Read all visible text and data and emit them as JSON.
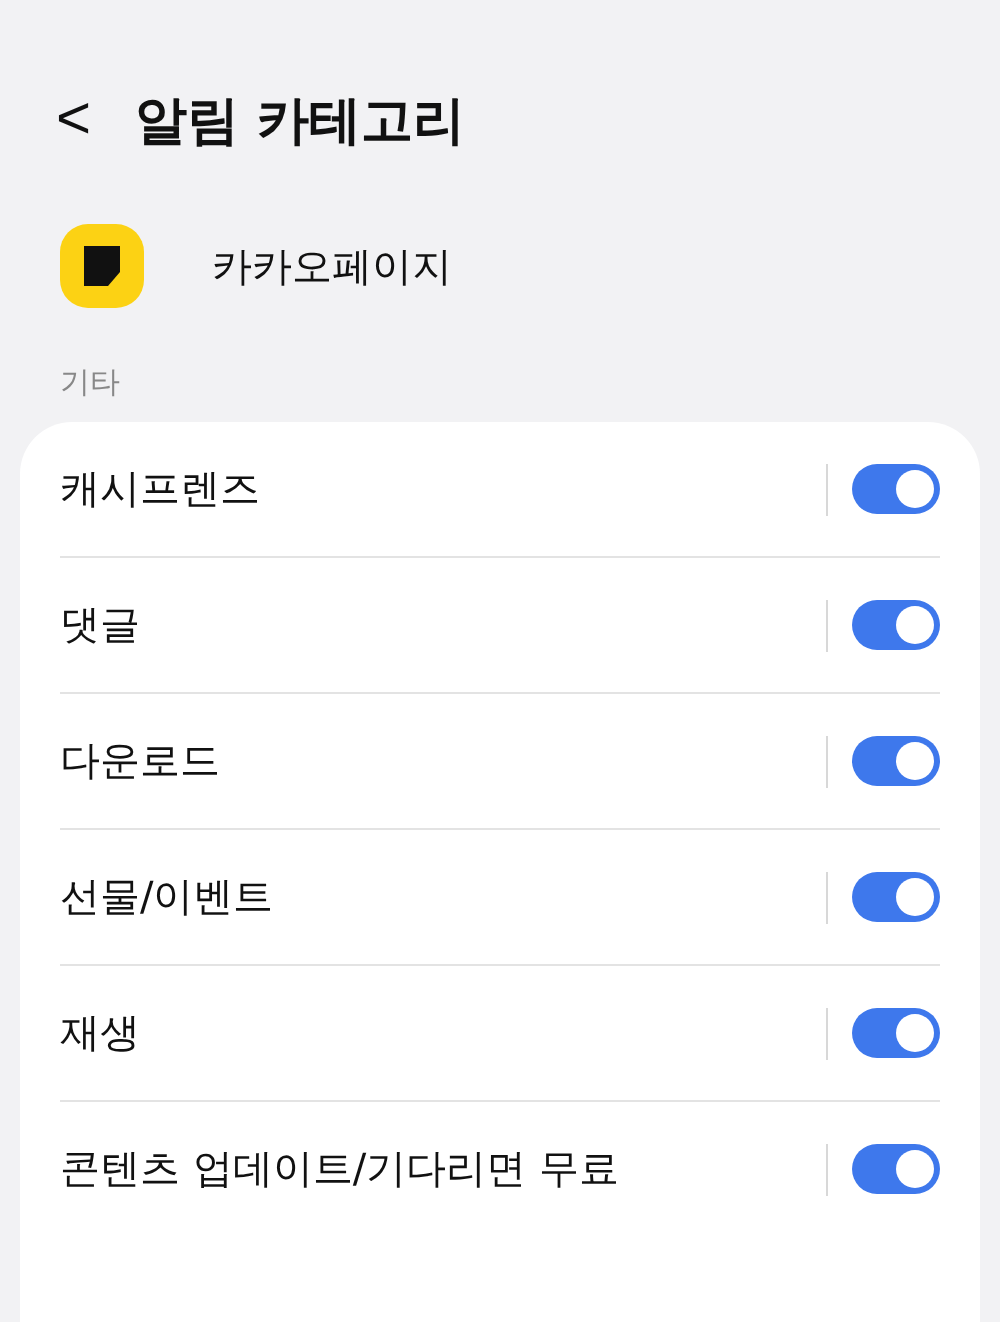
{
  "header": {
    "back": "<",
    "title": "알림 카테고리"
  },
  "app": {
    "name": "카카오페이지"
  },
  "section": {
    "label": "기타"
  },
  "items": [
    {
      "label": "캐시프렌즈",
      "on": true
    },
    {
      "label": "댓글",
      "on": true
    },
    {
      "label": "다운로드",
      "on": true
    },
    {
      "label": "선물/이벤트",
      "on": true
    },
    {
      "label": "재생",
      "on": true
    },
    {
      "label": "콘텐츠 업데이트/기다리면 무료",
      "on": true
    }
  ]
}
